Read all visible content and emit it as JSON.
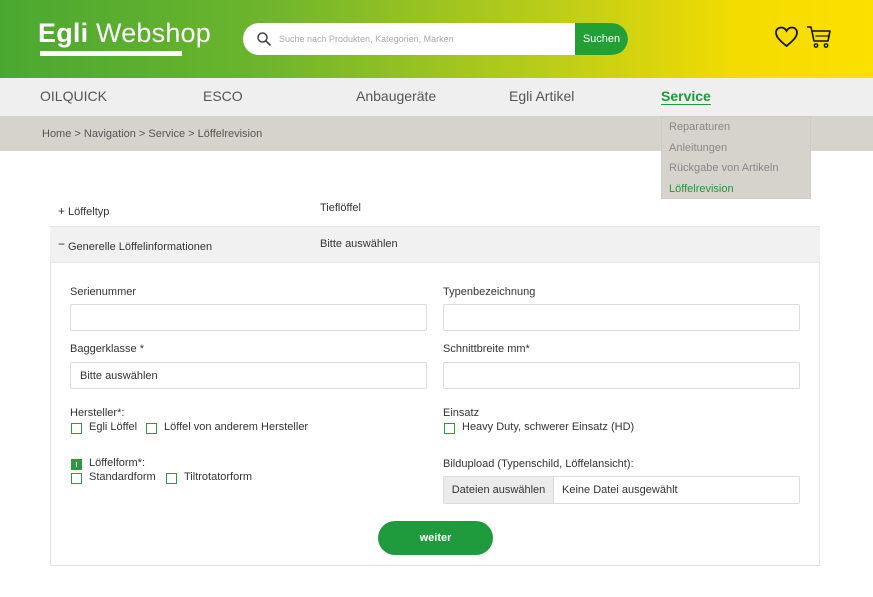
{
  "brand": {
    "bold": "Egli",
    "light": " Webshop"
  },
  "search": {
    "placeholder": "Suche nach Produkten, Kategorien, Marken",
    "button": "Suchen"
  },
  "header_icons": [
    "heart-icon",
    "cart-icon"
  ],
  "nav": {
    "items": [
      "OILQUICK",
      "ESCO",
      "Anbaugeräte",
      "Egli Artikel",
      "Service"
    ],
    "active": "Service"
  },
  "breadcrumb": "Home > Navigation > Service > Löffelrevision",
  "service_menu": {
    "items": [
      "Reparaturen",
      "Anleitungen",
      "Rückgabe von Artikeln",
      "Löffelrevision"
    ],
    "active": "Löffelrevision"
  },
  "accordion": {
    "typ": {
      "sign": "+",
      "label": "Löffeltyp",
      "value": "Tieflöffel"
    },
    "info": {
      "sign": "−",
      "label": "Generelle Löffelinformationen",
      "value": "Bitte auswählen"
    }
  },
  "form": {
    "serial_label": "Serienummer",
    "serial_value": "",
    "type_label": "Typenbezeichnung",
    "type_value": "",
    "class_label": "Baggerklasse *",
    "class_value": "Bitte auswählen",
    "width_label": "Schnittbreite mm*",
    "width_value": "",
    "manufacturer_label": "Hersteller*:",
    "manufacturer_options": [
      {
        "label": "Egli Löffel",
        "checked": false
      },
      {
        "label": "Löffel von anderem Hersteller",
        "checked": false
      }
    ],
    "usage_label": "Einsatz",
    "usage_options": [
      {
        "label": "Heavy Duty, schwerer Einsatz (HD)",
        "checked": false
      }
    ],
    "shape_label": "Löffelform*:",
    "shape_label_checked": true,
    "shape_options": [
      {
        "label": "Standardform",
        "checked": false
      },
      {
        "label": "Tiltrotatorform",
        "checked": false
      }
    ],
    "upload_label": "Bildupload (Typenschild, Löffelansicht):",
    "upload_button": "Dateien auswählen",
    "upload_status": "Keine Datei ausgewählt",
    "submit": "weiter"
  },
  "colors": {
    "brand_green": "#20a035",
    "header_gradient_start": "#4aa830",
    "header_gradient_end": "#fbe100",
    "nav_bg": "#efefef",
    "breadcrumb_bg": "#d6d3cd"
  }
}
